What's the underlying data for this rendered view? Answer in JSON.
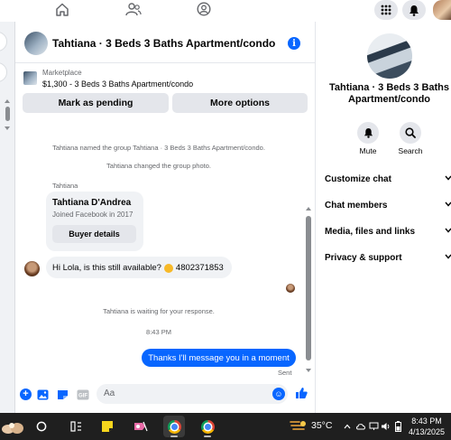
{
  "top_nav": {
    "icons": [
      "home-icon",
      "people-icon",
      "profile-circle-icon",
      "grid-menu-icon",
      "bell-icon",
      "user-avatar"
    ]
  },
  "chat": {
    "title": "Tahtiana · 3 Beds 3 Baths Apartment/condo",
    "marketplace": {
      "caption": "Marketplace",
      "price_title": "$1,300 - 3 Beds 3 Baths Apartment/condo",
      "mark_pending_label": "Mark as pending",
      "more_options_label": "More options"
    },
    "system_messages": [
      "Tahtiana named the group Tahtiana · 3 Beds 3 Baths Apartment/condo.",
      "Tahtiana changed the group photo."
    ],
    "sender_caption": "Tahtiana",
    "profile_card": {
      "name": "Tahtiana D'Andrea",
      "joined": "Joined Facebook in 2017",
      "buyer_details_label": "Buyer details"
    },
    "incoming": {
      "before_emoji": "Hi Lola, is this still available?",
      "after_emoji": "4802371853"
    },
    "waiting_text": "Tahtiana is waiting for your response.",
    "timestamp": "8:43 PM",
    "outgoing": "Thanks I'll message you in a moment",
    "sent_status": "Sent",
    "composer": {
      "placeholder": "Aa",
      "icons": [
        "plus-icon",
        "image-icon",
        "sticker-icon",
        "gif-icon",
        "emoji-icon",
        "thumbs-up-icon"
      ]
    }
  },
  "side_panel": {
    "title": "Tahtiana · 3 Beds 3 Baths Apartment/condo",
    "actions": [
      {
        "label": "Mute",
        "icon": "bell-icon"
      },
      {
        "label": "Search",
        "icon": "search-icon"
      }
    ],
    "sections": [
      "Customize chat",
      "Chat members",
      "Media, files and links",
      "Privacy & support"
    ]
  },
  "taskbar": {
    "temperature": "35°C",
    "time": "8:43 PM",
    "date": "4/13/2025"
  },
  "colors": {
    "accent": "#0866ff",
    "bubble_gray": "#f0f2f5",
    "button_gray": "#e4e6eb",
    "taskbar": "#1f1f1f"
  }
}
